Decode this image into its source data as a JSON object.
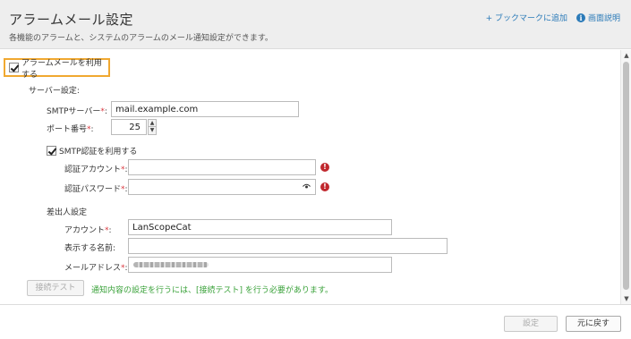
{
  "header": {
    "title": "アラームメール設定",
    "subtitle": "各機能のアラームと、システムのアラームのメール通知設定ができます。",
    "bookmark_link": "+ ブックマークに追加",
    "help_link": "画面説明",
    "help_icon_glyph": "i"
  },
  "alarm_mail": {
    "use_label": "アラームメールを利用する",
    "use_checked": true
  },
  "server": {
    "section_label": "サーバー設定:",
    "smtp_label": "SMTPサーバー",
    "smtp_value": "mail.example.com",
    "port_label": "ポート番号",
    "port_value": "25",
    "required_mark": "*",
    "colon": ":",
    "spinner_up": "▲",
    "spinner_down": "▼",
    "auth_use_label": "SMTP認証を利用する",
    "auth_use_checked": true,
    "auth_account_label": "認証アカウント",
    "auth_account_value": "",
    "auth_password_label": "認証パスワード",
    "auth_password_value": "",
    "warn_glyph": "!"
  },
  "sender": {
    "section_label": "差出人設定",
    "account_label": "アカウント",
    "account_value": "LanScopeCat",
    "display_name_label": "表示する名前",
    "display_name_value": "",
    "mail_address_label": "メールアドレス"
  },
  "connection": {
    "test_button": "接続テスト",
    "notice": "通知内容の設定を行うには、[接続テスト] を行う必要があります。"
  },
  "footer": {
    "set_button": "設定",
    "back_button": "元に戻す"
  },
  "scrollbar": {
    "up_glyph": "▲",
    "down_glyph": "▼"
  },
  "colors": {
    "highlight": "#f0a830",
    "required": "#d9363e",
    "link": "#2a7ab8",
    "notice": "#3aa23a",
    "warning": "#c0282e"
  }
}
